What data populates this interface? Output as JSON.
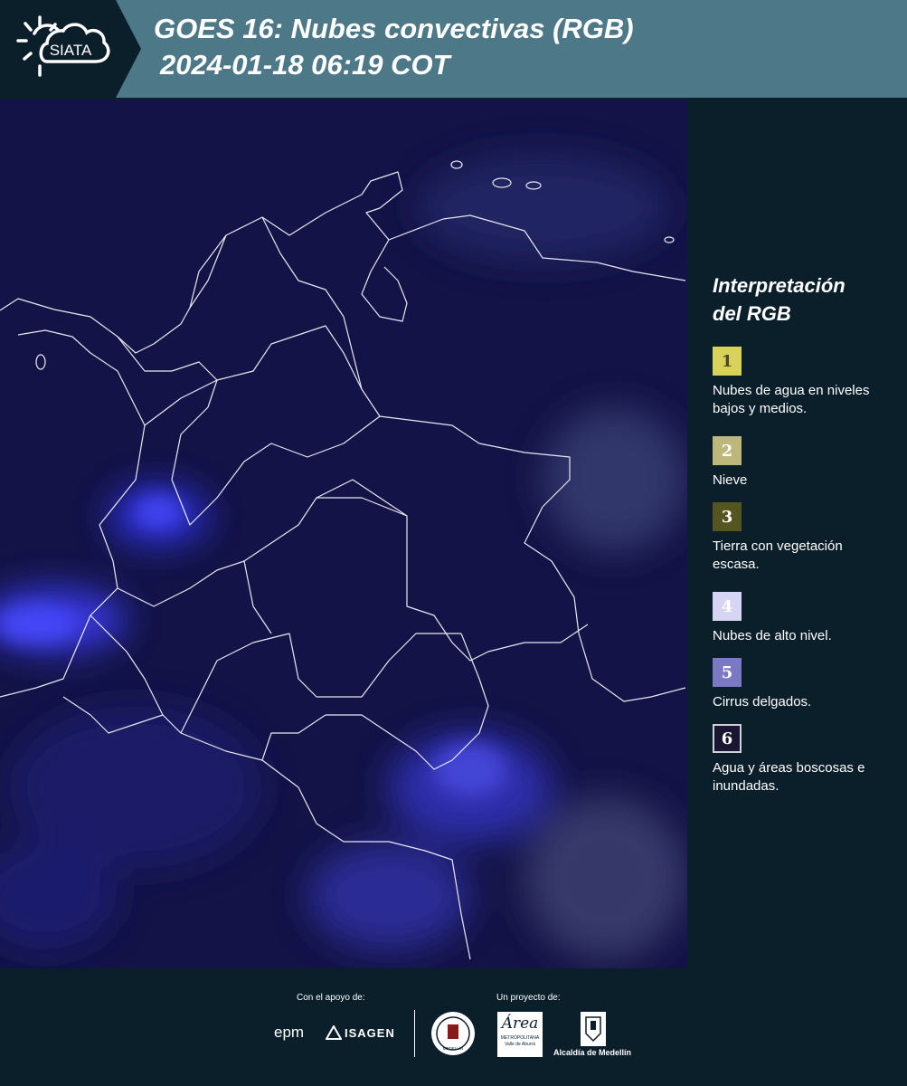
{
  "header": {
    "logo_text": "SIATA",
    "title_line1": "GOES 16: Nubes convectivas (RGB)",
    "title_line2": "2024-01-18 06:19 COT"
  },
  "legend": {
    "title_line1": "Interpretación",
    "title_line2": "del RGB",
    "items": [
      {
        "num": "1",
        "label": "Nubes de agua en niveles bajos y medios.",
        "color": "#d8d25a"
      },
      {
        "num": "2",
        "label": "Nieve",
        "color": "#bdb779"
      },
      {
        "num": "3",
        "label": "Tierra con vegetación escasa.",
        "color": "#555521"
      },
      {
        "num": "4",
        "label": "Nubes de alto nivel.",
        "color": "#d7d5f4"
      },
      {
        "num": "5",
        "label": "Cirrus delgados.",
        "color": "#7b78c4"
      },
      {
        "num": "6",
        "label": "Agua y áreas boscosas e inundadas.",
        "color": "#1a1530"
      }
    ]
  },
  "footer": {
    "support_label": "Con el apoyo de:",
    "project_label": "Un proyecto de:",
    "sponsor_epm": "epm",
    "sponsor_isagen": "ISAGEN",
    "logo_medellin_seal": "MEDELLÍN",
    "logo_area_main": "Área",
    "logo_area_sub1": "METROPOLITANA",
    "logo_area_sub2": "Valle de Aburrá",
    "logo_alcaldia": "Alcaldía de Medellín"
  }
}
